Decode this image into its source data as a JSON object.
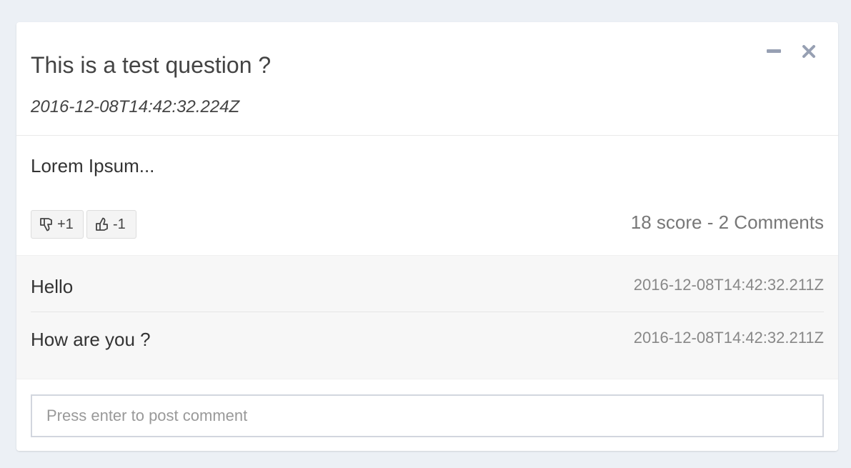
{
  "question": {
    "title": "This is a test question ?",
    "timestamp": "2016-12-08T14:42:32.224Z",
    "body": "Lorem Ipsum...",
    "score_summary": "18 score - 2 Comments"
  },
  "tools": {
    "minimize_icon": "minus-icon",
    "close_icon": "times-icon"
  },
  "votes": {
    "down_label": "+1",
    "down_icon": "thumbs-down-icon",
    "up_label": "-1",
    "up_icon": "thumbs-up-icon"
  },
  "comments": [
    {
      "text": "Hello",
      "time": "2016-12-08T14:42:32.211Z"
    },
    {
      "text": "How are you ?",
      "time": "2016-12-08T14:42:32.211Z"
    }
  ],
  "comment_input": {
    "placeholder": "Press enter to post comment",
    "value": ""
  },
  "colors": {
    "page_background": "#ecf0f5",
    "box_background": "#ffffff",
    "comments_background": "#f7f7f7",
    "tool_icon": "#97a0b3"
  }
}
